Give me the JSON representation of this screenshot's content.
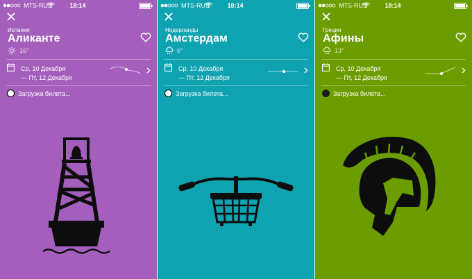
{
  "colors": {
    "accent_purple": "#a45fbd",
    "accent_teal": "#0fa3b1",
    "accent_olive": "#6c9d00",
    "illustration": "#0d0d0d"
  },
  "panels": [
    {
      "status_bar": {
        "carrier": "MTS-RUS",
        "time": "18:14"
      },
      "close_icon": "close-icon",
      "country": "Испания",
      "city": "Аликанте",
      "weather_icon": "sun-icon",
      "temperature": "16°",
      "favorite_icon": "heart-outline-icon",
      "dates": {
        "from": "Ср, 10 Декабря",
        "to": "— Пт, 12 Декабря"
      },
      "status": "Загрузка билета...",
      "illustration": "buoy-with-bell"
    },
    {
      "status_bar": {
        "carrier": "MTS-RUS",
        "time": "18:14"
      },
      "close_icon": "close-icon",
      "country": "Нидерланды",
      "city": "Амстердам",
      "weather_icon": "rain-cloud-icon",
      "temperature": "6°",
      "favorite_icon": "heart-outline-icon",
      "dates": {
        "from": "Ср, 10 Декабря",
        "to": "— Пт, 12 Декабря"
      },
      "status": "Загрузка билета...",
      "illustration": "bicycle-handlebar-with-basket"
    },
    {
      "status_bar": {
        "carrier": "MTS-RUS",
        "time": "18:14"
      },
      "close_icon": "close-icon",
      "country": "Греция",
      "city": "Афины",
      "weather_icon": "rain-cloud-icon",
      "temperature": "13°",
      "favorite_icon": "heart-outline-icon",
      "dates": {
        "from": "Ср, 10 Декабря",
        "to": "— Пт, 12 Декабря"
      },
      "status": "Загрузка билета...",
      "illustration": "spartan-helmet"
    }
  ]
}
